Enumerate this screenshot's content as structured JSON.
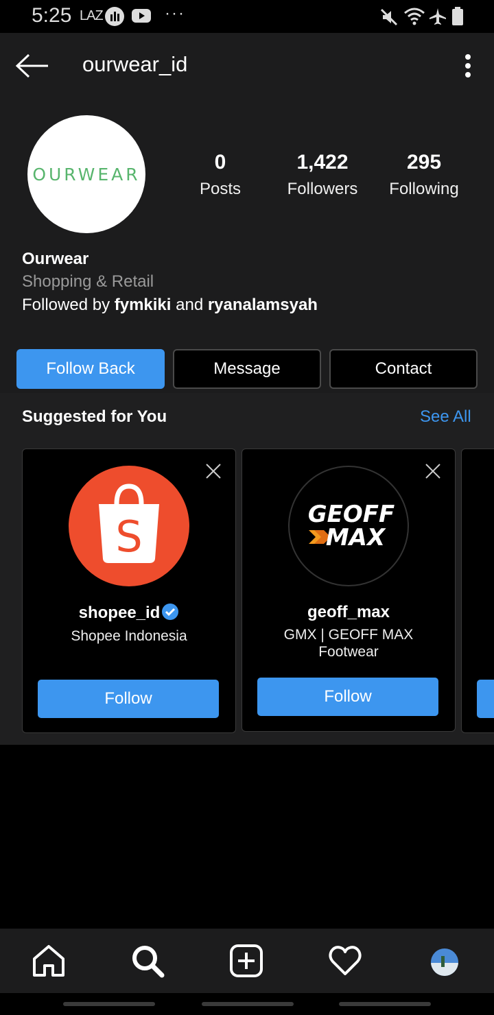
{
  "status_bar": {
    "time": "5:25",
    "laz": "LAZ",
    "more": "···"
  },
  "header": {
    "username": "ourwear_id"
  },
  "profile": {
    "avatar_text": "OURWEAR",
    "stats": [
      {
        "value": "0",
        "label": "Posts"
      },
      {
        "value": "1,422",
        "label": "Followers"
      },
      {
        "value": "295",
        "label": "Following"
      }
    ],
    "name": "Ourwear",
    "category": "Shopping & Retail",
    "followed_by_prefix": "Followed by ",
    "followed_by_user1": "fymkiki",
    "followed_by_and": " and ",
    "followed_by_user2": "ryanalamsyah"
  },
  "actions": {
    "follow_back": "Follow Back",
    "message": "Message",
    "contact": "Contact"
  },
  "suggested": {
    "title": "Suggested for You",
    "see_all": "See All",
    "cards": [
      {
        "username": "shopee_id",
        "full_name": "Shopee Indonesia",
        "follow": "Follow",
        "verified": true,
        "avatar_letter": "S"
      },
      {
        "username": "geoff_max",
        "full_name": "GMX | GEOFF MAX Footwear",
        "follow": "Follow",
        "verified": false,
        "avatar_text1": "GEOFF",
        "avatar_text2": "MAX"
      }
    ]
  },
  "colors": {
    "accent": "#3d96ef",
    "shopee": "#ee4d2d",
    "geoff_orange": "#f39a1e"
  }
}
